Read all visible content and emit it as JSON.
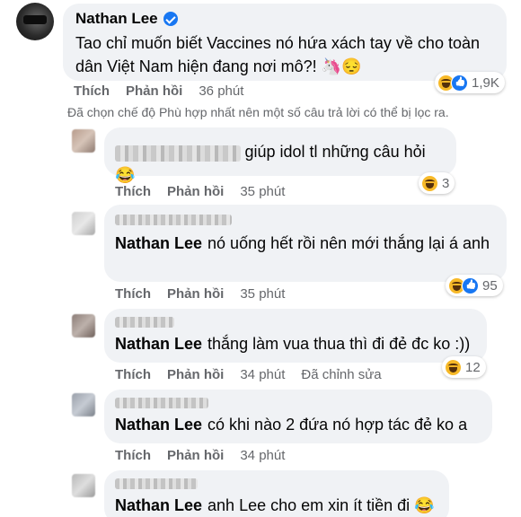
{
  "main_comment": {
    "author": "Nathan Lee",
    "text": "Tao chỉ muốn biết Vaccines nó hứa xách tay về cho toàn dân Việt Nam hiện đang nơi mô?! 🦄😔",
    "like_label": "Thích",
    "reply_label": "Phản hồi",
    "time": "36 phút",
    "reaction_count": "1,9K"
  },
  "filter_note": "Đã chọn chế độ Phù hợp nhất nên một số câu trả lời có thể bị lọc ra.",
  "replies": [
    {
      "mention": "",
      "text": "giúp idol tl những câu hỏi 😂",
      "like_label": "Thích",
      "reply_label": "Phản hồi",
      "time": "35 phút",
      "edited": "",
      "reaction_count": "3"
    },
    {
      "mention": "Nathan Lee",
      "text": "nó uống hết rồi nên mới thắng lại á anh",
      "like_label": "Thích",
      "reply_label": "Phản hồi",
      "time": "35 phút",
      "edited": "",
      "reaction_count": "95"
    },
    {
      "mention": "Nathan Lee",
      "text": "thắng làm vua thua thì đi đẻ đc ko :))",
      "like_label": "Thích",
      "reply_label": "Phản hồi",
      "time": "34 phút",
      "edited": "Đã chỉnh sửa",
      "reaction_count": "12"
    },
    {
      "mention": "Nathan Lee",
      "text": "có khi nào 2 đứa nó hợp tác đẻ ko a",
      "like_label": "Thích",
      "reply_label": "Phản hồi",
      "time": "34 phút",
      "edited": "",
      "reaction_count": ""
    },
    {
      "mention": "Nathan Lee",
      "text": "anh Lee cho em xin ít tiền đi 😂",
      "like_label": "",
      "reply_label": "",
      "time": "",
      "edited": "",
      "reaction_count": ""
    }
  ],
  "colors": {
    "bubble": "#f0f2f5",
    "meta_text": "#65676b",
    "verified": "#1877f2",
    "haha": "#f7b928"
  }
}
